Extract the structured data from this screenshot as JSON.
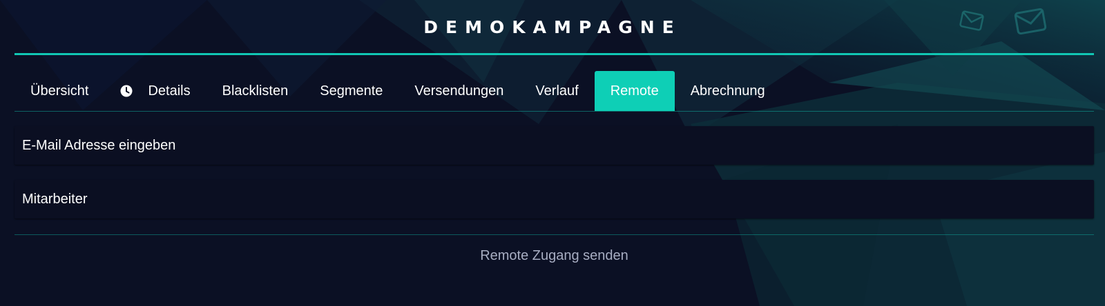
{
  "page": {
    "title": "DEMOKAMPAGNE"
  },
  "tabs": [
    {
      "label": "Übersicht",
      "icon": null,
      "active": false
    },
    {
      "label": "Details",
      "icon": "clock-icon",
      "active": false
    },
    {
      "label": "Blacklisten",
      "icon": null,
      "active": false
    },
    {
      "label": "Segmente",
      "icon": null,
      "active": false
    },
    {
      "label": "Versendungen",
      "icon": null,
      "active": false
    },
    {
      "label": "Verlauf",
      "icon": null,
      "active": false
    },
    {
      "label": "Remote",
      "icon": null,
      "active": true
    },
    {
      "label": "Abrechnung",
      "icon": null,
      "active": false
    }
  ],
  "form": {
    "email": {
      "value": "",
      "placeholder": "E-Mail Adresse eingeben"
    },
    "employee": {
      "value": "",
      "placeholder": "Mitarbeiter"
    },
    "submit_label": "Remote Zugang senden"
  },
  "background": {
    "decor_icons": [
      "envelope-icon",
      "envelope-icon"
    ]
  },
  "colors": {
    "accent": "#0ecfb6",
    "background": "#0b1024",
    "field_bg": "#0b0f22",
    "muted_text": "#a7adc2"
  }
}
